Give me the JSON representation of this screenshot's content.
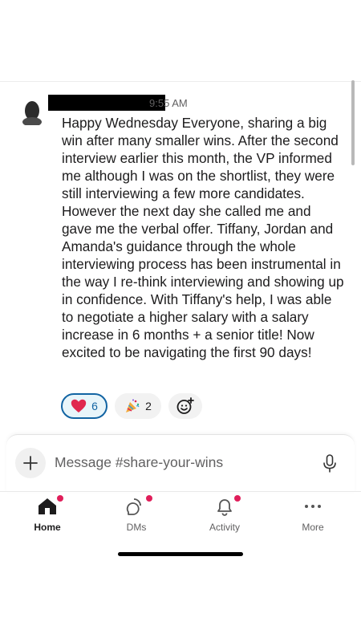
{
  "message": {
    "time": "9:55 AM",
    "text": "Happy Wednesday Everyone, sharing a big win after many smaller wins. After the second interview earlier this month, the VP informed me although I was on the shortlist, they were still interviewing a few more candidates. However the next day she called me and gave me the verbal offer. Tiffany, Jordan and Amanda's guidance through the whole interviewing process has been instrumental in the way I re-think interviewing and showing up in confidence. With Tiffany's help, I was able to negotiate a higher salary with a salary increase in 6 months + a senior title! Now excited to be navigating the first 90 days!"
  },
  "reactions": [
    {
      "emoji": "heart",
      "count": "6",
      "selected": true
    },
    {
      "emoji": "party-popper",
      "count": "2",
      "selected": false
    }
  ],
  "composer": {
    "placeholder": "Message #share-your-wins"
  },
  "nav": {
    "home": "Home",
    "dms": "DMs",
    "activity": "Activity",
    "more": "More"
  },
  "colors": {
    "accent": "#1264a3",
    "badge": "#e01e5a",
    "heart": "#e0284f"
  }
}
